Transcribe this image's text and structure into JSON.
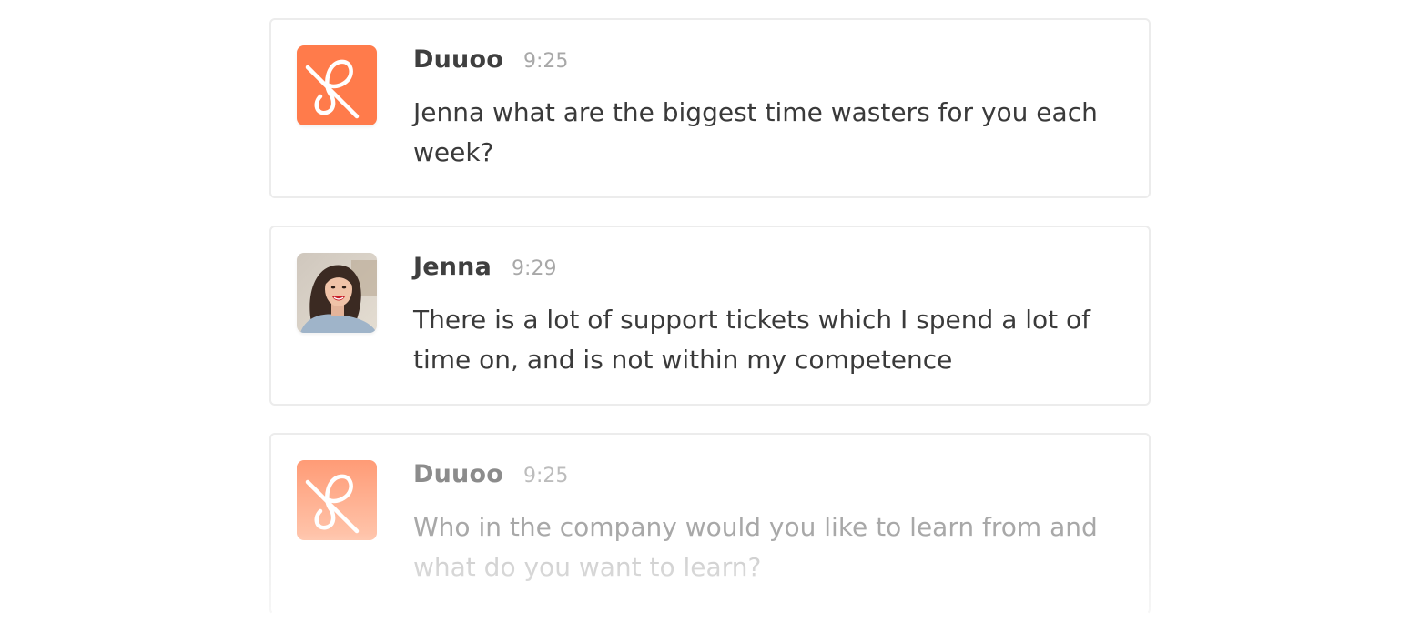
{
  "messages": [
    {
      "author": "Duuoo",
      "time": "9:25",
      "text": "Jenna what are the biggest time wasters for you each week?",
      "avatar": "duuoo-logo-icon"
    },
    {
      "author": "Jenna",
      "time": "9:29",
      "text": "There is a lot of support tickets which I spend a lot of time on, and is not within my competence",
      "avatar": "user-photo"
    },
    {
      "author": "Duuoo",
      "time": "9:25",
      "text_line1": "Who in the company would you like to learn from and",
      "text_line2": "what do you want to learn?",
      "avatar": "duuoo-logo-icon"
    }
  ],
  "colors": {
    "brand": "#ff7b4b",
    "border": "#ececec",
    "author": "#3f3f3f",
    "time": "#a8a8a8"
  }
}
